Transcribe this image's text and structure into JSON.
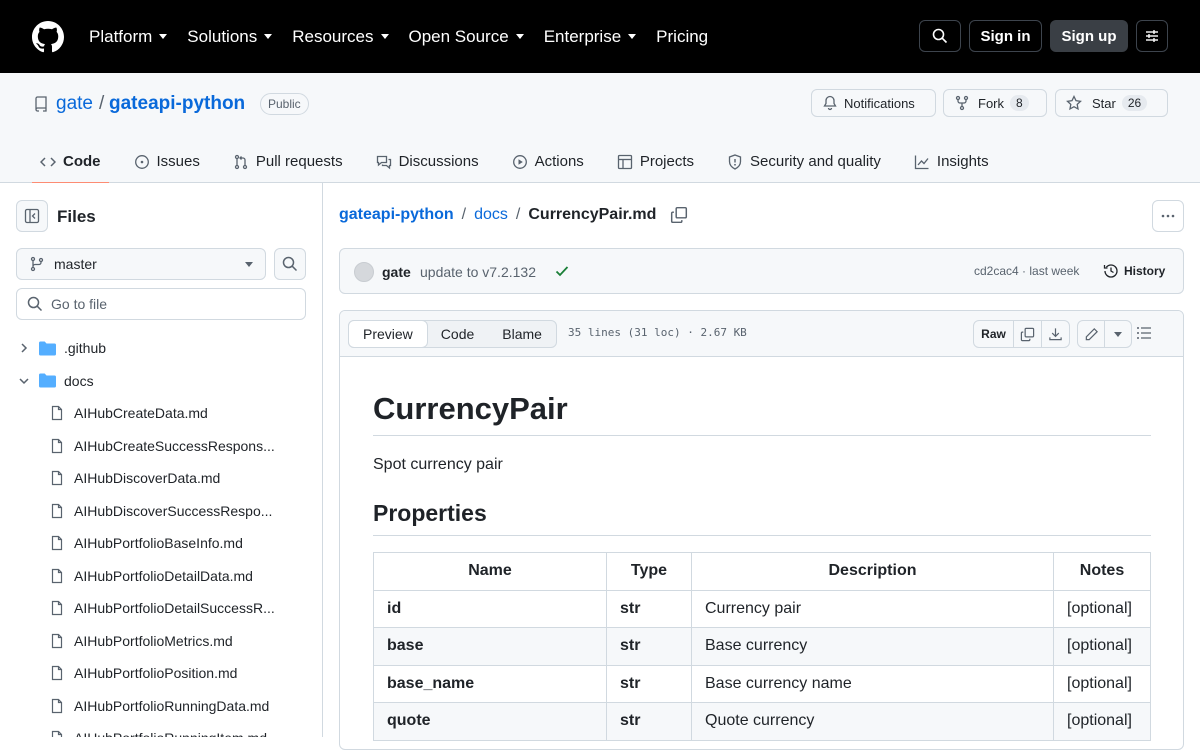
{
  "topnav": {
    "items": [
      "Platform",
      "Solutions",
      "Resources",
      "Open Source",
      "Enterprise",
      "Pricing"
    ],
    "signin": "Sign in",
    "signup": "Sign up"
  },
  "repo": {
    "owner": "gate",
    "separator": "/",
    "name": "gateapi-python",
    "visibility": "Public",
    "notifications": "Notifications",
    "fork_label": "Fork",
    "fork_count": "8",
    "star_label": "Star",
    "star_count": "26"
  },
  "tabs": [
    "Code",
    "Issues",
    "Pull requests",
    "Discussions",
    "Actions",
    "Projects",
    "Security and quality",
    "Insights"
  ],
  "sidebar": {
    "title": "Files",
    "branch": "master",
    "goto_placeholder": "Go to file",
    "folders": [
      ".github",
      "docs"
    ],
    "files": [
      "AIHubCreateData.md",
      "AIHubCreateSuccessRespons...",
      "AIHubDiscoverData.md",
      "AIHubDiscoverSuccessRespo...",
      "AIHubPortfolioBaseInfo.md",
      "AIHubPortfolioDetailData.md",
      "AIHubPortfolioDetailSuccessR...",
      "AIHubPortfolioMetrics.md",
      "AIHubPortfolioPosition.md",
      "AIHubPortfolioRunningData.md",
      "AIHubPortfolioRunningItem.md"
    ]
  },
  "breadcrumb": {
    "repo": "gateapi-python",
    "dir": "docs",
    "file": "CurrencyPair.md",
    "sep": "/"
  },
  "commit": {
    "author": "gate",
    "message": "update to v7.2.132",
    "sha_time": "cd2cac4 · last week",
    "history": "History"
  },
  "file": {
    "views": [
      "Preview",
      "Code",
      "Blame"
    ],
    "info": "35 lines (31 loc) · 2.67 KB",
    "raw": "Raw"
  },
  "markdown": {
    "h1": "CurrencyPair",
    "description": "Spot currency pair",
    "h2": "Properties",
    "table_headers": [
      "Name",
      "Type",
      "Description",
      "Notes"
    ],
    "rows": [
      [
        "id",
        "str",
        "Currency pair",
        "[optional]"
      ],
      [
        "base",
        "str",
        "Base currency",
        "[optional]"
      ],
      [
        "base_name",
        "str",
        "Base currency name",
        "[optional]"
      ],
      [
        "quote",
        "str",
        "Quote currency",
        "[optional]"
      ]
    ]
  },
  "colors": {
    "link": "#0969da",
    "accent_underline": "#fd8c73",
    "success": "#1a7f37"
  }
}
